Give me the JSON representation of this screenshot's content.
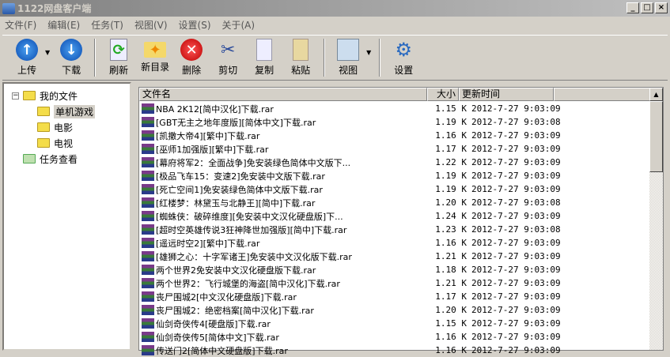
{
  "window": {
    "title": "1122网盘客户端",
    "min": "_",
    "max": "□",
    "close": "×"
  },
  "menu": [
    "文件(F)",
    "编辑(E)",
    "任务(T)",
    "视图(V)",
    "设置(S)",
    "关于(A)"
  ],
  "toolbar": {
    "upload": "上传",
    "download": "下载",
    "refresh": "刷新",
    "newdir": "新目录",
    "delete": "删除",
    "cut": "剪切",
    "copy": "复制",
    "paste": "粘贴",
    "view": "视图",
    "settings": "设置"
  },
  "tree": {
    "root": "我的文件",
    "children": [
      "单机游戏",
      "电影",
      "电视"
    ],
    "tasks": "任务查看",
    "expander": "−"
  },
  "columns": {
    "name": "文件名",
    "size": "大小",
    "time": "更新时间"
  },
  "files": [
    {
      "name": "NBA 2K12[简中汉化]下载.rar",
      "size": "1.15 K",
      "time": "2012-7-27 9:03:09"
    },
    {
      "name": "[GBT无主之地年度版][简体中文]下载.rar",
      "size": "1.19 K",
      "time": "2012-7-27 9:03:08"
    },
    {
      "name": "[凯撒大帝4][繁中]下载.rar",
      "size": "1.16 K",
      "time": "2012-7-27 9:03:09"
    },
    {
      "name": "[巫师1加强版][繁中]下载.rar",
      "size": "1.17 K",
      "time": "2012-7-27 9:03:09"
    },
    {
      "name": "[幕府将军2：全面战争]免安装绿色简体中文版下...",
      "size": "1.22 K",
      "time": "2012-7-27 9:03:09"
    },
    {
      "name": "[极品飞车15：变速2]免安装中文版下载.rar",
      "size": "1.19 K",
      "time": "2012-7-27 9:03:09"
    },
    {
      "name": "[死亡空间1]免安装绿色简体中文版下载.rar",
      "size": "1.19 K",
      "time": "2012-7-27 9:03:09"
    },
    {
      "name": "[红楼梦：林黛玉与北静王][简中]下载.rar",
      "size": "1.20 K",
      "time": "2012-7-27 9:03:08"
    },
    {
      "name": "[蜘蛛侠：破碎维度][免安装中文汉化硬盘版]下...",
      "size": "1.24 K",
      "time": "2012-7-27 9:03:09"
    },
    {
      "name": "[超时空英雄传说3狂神降世加强版][简中]下载.rar",
      "size": "1.23 K",
      "time": "2012-7-27 9:03:08"
    },
    {
      "name": "[遥远时空2][繁中]下载.rar",
      "size": "1.16 K",
      "time": "2012-7-27 9:03:09"
    },
    {
      "name": "[雄狮之心：十字军诸王]免安装中文汉化版下载.rar",
      "size": "1.21 K",
      "time": "2012-7-27 9:03:09"
    },
    {
      "name": "两个世界2免安装中文汉化硬盘版下载.rar",
      "size": "1.18 K",
      "time": "2012-7-27 9:03:09"
    },
    {
      "name": "两个世界2：飞行城堡的海盗[简中汉化]下载.rar",
      "size": "1.21 K",
      "time": "2012-7-27 9:03:09"
    },
    {
      "name": "丧尸围城2[中文汉化硬盘版]下载.rar",
      "size": "1.17 K",
      "time": "2012-7-27 9:03:09"
    },
    {
      "name": "丧尸围城2：绝密档案[简中汉化]下载.rar",
      "size": "1.20 K",
      "time": "2012-7-27 9:03:09"
    },
    {
      "name": "仙剑奇侠传4[硬盘版]下载.rar",
      "size": "1.15 K",
      "time": "2012-7-27 9:03:09"
    },
    {
      "name": "仙剑奇侠传5[简体中文]下载.rar",
      "size": "1.16 K",
      "time": "2012-7-27 9:03:09"
    },
    {
      "name": "传送门2[简体中文硬盘版]下载.rar",
      "size": "1.16 K",
      "time": "2012-7-27 9:03:09"
    }
  ]
}
